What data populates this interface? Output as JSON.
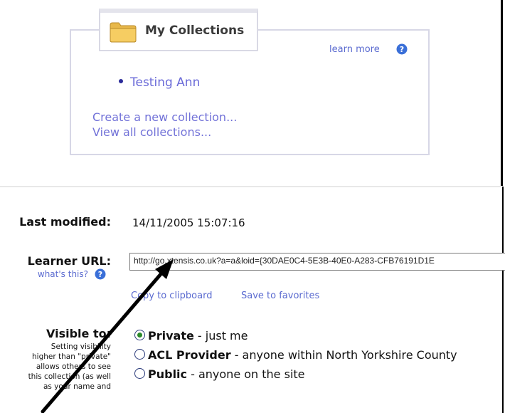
{
  "collections": {
    "title": "My Collections",
    "learn_more": "learn more",
    "items": [
      "Testing Ann"
    ],
    "create_link": "Create a new collection...",
    "view_link": "View all collections..."
  },
  "form": {
    "last_modified_label": "Last modified:",
    "last_modified_value": "14/11/2005 15:07:16",
    "learner_url_label": "Learner URL:",
    "whats_this": "what's this?",
    "learner_url_value": "http://go.xtensis.co.uk?a=a&loid={30DAE0C4-5E3B-40E0-A283-CFB76191D1E",
    "copy_to_clipboard": "Copy to clipboard",
    "save_to_favorites": "Save to favorites",
    "visible_to_label": "Visible to:",
    "visible_to_desc": "Setting visibility higher than \"private\" allows others to see this collection (as well as your name and",
    "options": [
      {
        "name": "Private",
        "desc": " - just me",
        "checked": true
      },
      {
        "name": "ACL Provider",
        "desc": " - anyone within North Yorkshire County",
        "checked": false
      },
      {
        "name": "Public",
        "desc": " - anyone on the site",
        "checked": false
      }
    ]
  },
  "colors": {
    "link": "#5b6bd0",
    "accent": "#2a8a2a"
  }
}
